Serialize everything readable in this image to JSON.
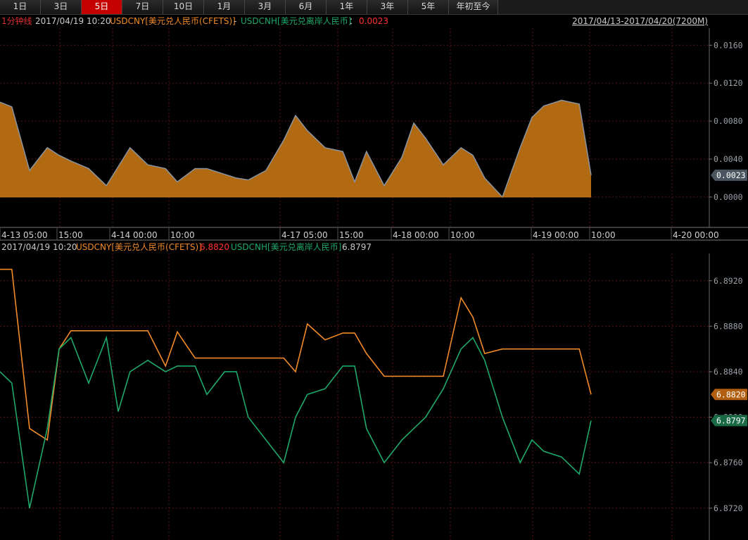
{
  "tabs": [
    {
      "label": "1日",
      "active": false
    },
    {
      "label": "3日",
      "active": false
    },
    {
      "label": "5日",
      "active": true
    },
    {
      "label": "7日",
      "active": false
    },
    {
      "label": "10日",
      "active": false
    },
    {
      "label": "1月",
      "active": false
    },
    {
      "label": "3月",
      "active": false
    },
    {
      "label": "6月",
      "active": false
    },
    {
      "label": "1年",
      "active": false
    },
    {
      "label": "3年",
      "active": false
    },
    {
      "label": "5年",
      "active": false
    },
    {
      "label": "年初至今",
      "active": false
    }
  ],
  "top_panel": {
    "interval": "1分钟线",
    "datetime": "2017/04/19 10:20",
    "series_a": "USDCNY[美元兑人民币(CFETS)]",
    "minus": "-",
    "series_b": "USDCNH[美元兑离岸人民币]",
    "colon": "：",
    "value": "0.0023",
    "range": "2017/04/13-2017/04/20(7200M)"
  },
  "bottom_panel": {
    "datetime": "2017/04/19 10:20",
    "series_a": "USDCNY[美元兑人民币(CFETS)]",
    "series_a_value": "6.8820",
    "series_b": "USDCNH[美元兑离岸人民币]",
    "series_b_value": "6.8797"
  },
  "x_axis_labels": [
    "4-13 05:00",
    "15:00",
    "4-14 00:00",
    "10:00",
    "4-17 05:00",
    "15:00",
    "4-18 00:00",
    "10:00",
    "4-19 00:00",
    "10:00",
    "4-20 00:00"
  ],
  "colors": {
    "cny": "#f08a28",
    "cnh": "#1fa86a",
    "spread_fill": "#b26a12",
    "spread_line": "#8a94a0",
    "grid": "#5a1414",
    "axis": "#9aa0a8"
  },
  "chart_data": [
    {
      "type": "area",
      "title": "USDCNY[美元兑人民币(CFETS)] - USDCNH[美元兑离岸人民币]",
      "y_ticks": [
        0.0,
        0.004,
        0.008,
        0.012,
        0.016
      ],
      "ylim": [
        -0.0032,
        0.0178
      ],
      "current_value": 0.0023,
      "x": [
        0,
        2,
        5,
        8,
        10,
        12,
        15,
        18,
        20,
        22,
        25,
        28,
        30,
        33,
        35,
        38,
        40,
        42,
        45,
        48,
        50,
        52,
        55,
        58,
        60,
        62,
        65,
        68,
        70,
        72,
        75,
        78,
        80,
        82,
        85,
        88,
        90,
        92,
        95,
        98,
        100
      ],
      "y": [
        0.01,
        0.0095,
        0.0028,
        0.0052,
        0.0044,
        0.0038,
        0.003,
        0.0012,
        0.0032,
        0.0052,
        0.0034,
        0.003,
        0.0016,
        0.003,
        0.003,
        0.0024,
        0.002,
        0.0018,
        0.0028,
        0.006,
        0.0086,
        0.007,
        0.0052,
        0.0048,
        0.0016,
        0.0048,
        0.0012,
        0.0042,
        0.0078,
        0.0062,
        0.0034,
        0.0052,
        0.0044,
        0.002,
        0.0,
        0.0052,
        0.0084,
        0.0096,
        0.0102,
        0.0098,
        0.0023
      ]
    },
    {
      "type": "line",
      "y_ticks": [
        6.872,
        6.876,
        6.88,
        6.884,
        6.888,
        6.892
      ],
      "ylim": [
        6.8692,
        6.8944
      ],
      "x": [
        0,
        2,
        5,
        8,
        10,
        12,
        15,
        18,
        20,
        22,
        25,
        28,
        30,
        33,
        35,
        38,
        40,
        42,
        45,
        48,
        50,
        52,
        55,
        58,
        60,
        62,
        65,
        68,
        70,
        72,
        75,
        78,
        80,
        82,
        85,
        88,
        90,
        92,
        95,
        98,
        100
      ],
      "series": [
        {
          "name": "USDCNY[美元兑人民币(CFETS)]",
          "values": [
            6.893,
            6.893,
            6.879,
            6.878,
            6.886,
            6.8876,
            6.8876,
            6.8876,
            6.8876,
            6.8876,
            6.8876,
            6.8845,
            6.8875,
            6.8852,
            6.8852,
            6.8852,
            6.8852,
            6.8852,
            6.8852,
            6.8852,
            6.884,
            6.8882,
            6.8868,
            6.8874,
            6.8874,
            6.8856,
            6.8836,
            6.8836,
            6.8836,
            6.8836,
            6.8836,
            6.8905,
            6.8888,
            6.8856,
            6.886,
            6.886,
            6.886,
            6.886,
            6.886,
            6.886,
            6.882
          ]
        },
        {
          "name": "USDCNH[美元兑离岸人民币]",
          "values": [
            6.884,
            6.883,
            6.872,
            6.879,
            6.886,
            6.887,
            6.883,
            6.887,
            6.8805,
            6.884,
            6.885,
            6.884,
            6.8845,
            6.8845,
            6.882,
            6.884,
            6.884,
            6.88,
            6.878,
            6.876,
            6.88,
            6.882,
            6.8825,
            6.8845,
            6.8845,
            6.879,
            6.876,
            6.878,
            6.879,
            6.88,
            6.8825,
            6.886,
            6.887,
            6.885,
            6.88,
            6.876,
            6.878,
            6.877,
            6.8765,
            6.875,
            6.8797
          ]
        }
      ]
    }
  ]
}
